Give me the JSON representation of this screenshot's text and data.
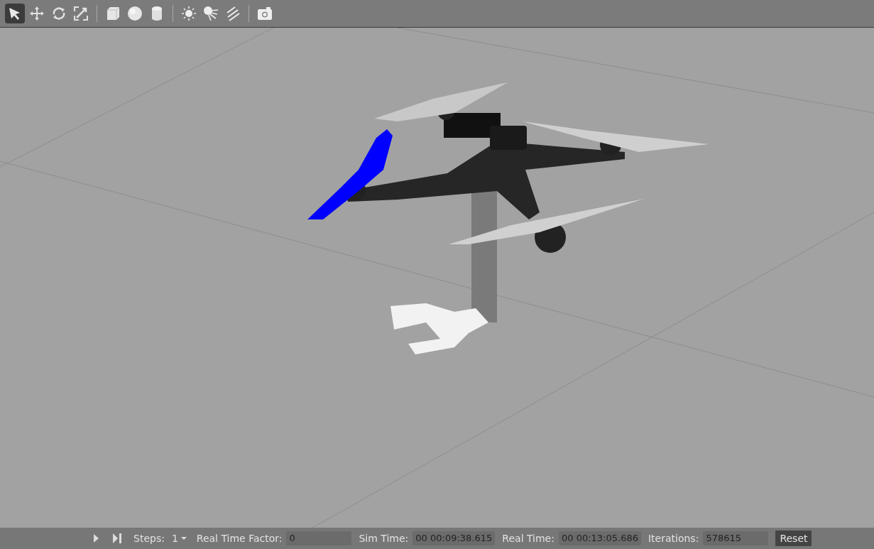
{
  "toolbar": {
    "tools": [
      {
        "kind": "select",
        "selected": true,
        "separator_before": false
      },
      {
        "kind": "translate",
        "selected": false,
        "separator_before": false
      },
      {
        "kind": "rotate",
        "selected": false,
        "separator_before": false
      },
      {
        "kind": "scale",
        "selected": false,
        "separator_before": false
      },
      {
        "kind": "box",
        "selected": false,
        "separator_before": true
      },
      {
        "kind": "sphere",
        "selected": false,
        "separator_before": false
      },
      {
        "kind": "cylinder",
        "selected": false,
        "separator_before": false
      },
      {
        "kind": "point_light",
        "selected": false,
        "separator_before": true
      },
      {
        "kind": "spot_light",
        "selected": false,
        "separator_before": false
      },
      {
        "kind": "directional_light",
        "selected": false,
        "separator_before": false
      },
      {
        "kind": "screenshot",
        "selected": false,
        "separator_before": true
      }
    ]
  },
  "status_bar": {
    "steps_label": "Steps:",
    "steps_value": "1",
    "fields": [
      {
        "label": "Real Time Factor:",
        "value": "0"
      },
      {
        "label": "Sim Time:",
        "value": "00 00:09:38.615"
      },
      {
        "label": "Real Time:",
        "value": "00 00:13:05.686"
      },
      {
        "label": "Iterations:",
        "value": "578615"
      }
    ],
    "reset": "Reset"
  }
}
